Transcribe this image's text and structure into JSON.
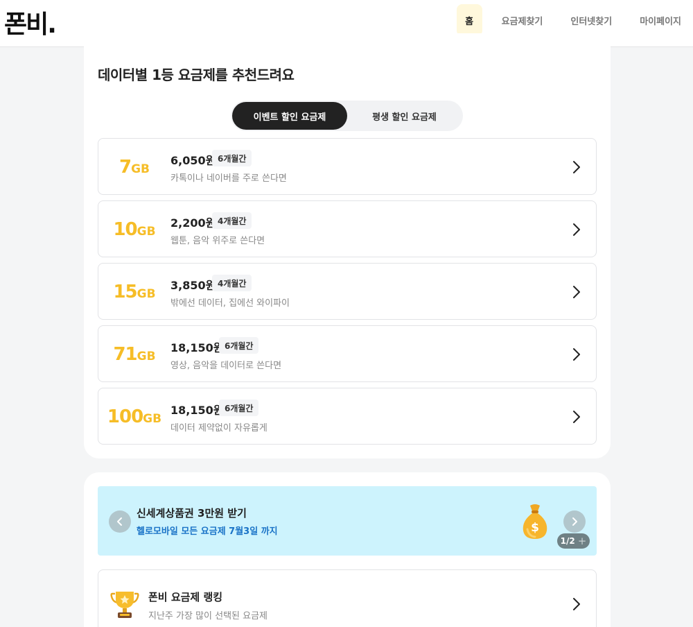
{
  "header": {
    "logo": "폰비.",
    "nav": [
      "홈",
      "요금제찾기",
      "인터넷찾기",
      "마이페이지"
    ]
  },
  "recommend": {
    "title": "데이터별 1등 요금제를 추천드려요",
    "tabs": [
      "이벤트 할인 요금제",
      "평생 할인 요금제"
    ],
    "plans": [
      {
        "gb": "7",
        "unit": "GB",
        "price": "6,050원",
        "period": "6개월간",
        "desc": "카톡이나 네이버를 주로 쓴다면"
      },
      {
        "gb": "10",
        "unit": "GB",
        "price": "2,200원",
        "period": "4개월간",
        "desc": "웹툰, 음악 위주로 쓴다면"
      },
      {
        "gb": "15",
        "unit": "GB",
        "price": "3,850원",
        "period": "4개월간",
        "desc": "밖에선 데이터, 집에선 와이파이"
      },
      {
        "gb": "71",
        "unit": "GB",
        "price": "18,150원",
        "period": "6개월간",
        "desc": "영상, 음악을 데이터로 쓴다면"
      },
      {
        "gb": "100",
        "unit": "GB",
        "price": "18,150원",
        "period": "6개월간",
        "desc": "데이터 제약없이 자유롭게"
      }
    ]
  },
  "banner": {
    "title": "신세계상품권 3만원 받기",
    "subtitle": "헬로모바일 모든 요금제 7월3일 까지",
    "pager": "1/2",
    "pager_plus": "+"
  },
  "ranking": {
    "title": "폰비 요금제 랭킹",
    "subtitle": "지난주 가장 많이 선택된 요금제"
  },
  "colors": {
    "accent_yellow": "#f6bd27",
    "banner_bg": "#cdf3fd",
    "banner_link": "#1a73c7",
    "dark": "#222222"
  }
}
